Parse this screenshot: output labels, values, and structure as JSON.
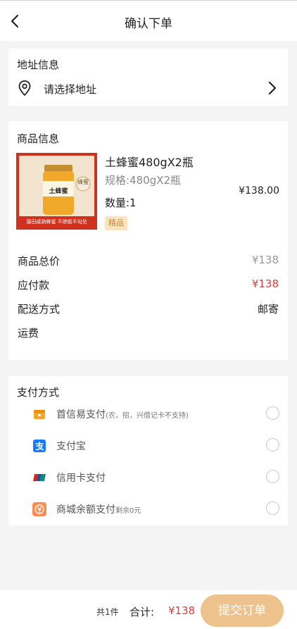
{
  "header": {
    "title": "确认下单"
  },
  "address": {
    "section_title": "地址信息",
    "placeholder": "请选择地址"
  },
  "goods": {
    "section_title": "商品信息",
    "image": {
      "jar_label": "土蜂蜜",
      "side_text": "蜂蜜",
      "banner": "蒲田成熟蜂蜜 不掺假不勾兑"
    },
    "name": "土蜂蜜480gX2瓶",
    "spec": "规格:480gX2瓶",
    "quantity": "数量:1",
    "price": "¥138.00",
    "tag": "精品"
  },
  "summary": {
    "rows": [
      {
        "label": "商品总价",
        "value": "¥138",
        "color": "#999999"
      },
      {
        "label": "应付款",
        "value": "¥138",
        "color": "#e53935"
      },
      {
        "label": "配送方式",
        "value": "邮寄",
        "color": "#222222"
      },
      {
        "label": "运费",
        "value": "",
        "color": "#222222"
      }
    ]
  },
  "payment": {
    "section_title": "支付方式",
    "methods": [
      {
        "label": "首信易支付",
        "note": "(农，招，兴借记卡不支持)",
        "icon": "wallet-icon"
      },
      {
        "label": "支付宝",
        "note": "",
        "icon": "alipay-icon"
      },
      {
        "label": "信用卡支付",
        "note": "",
        "icon": "unionpay-icon"
      },
      {
        "label": "商城余额支付",
        "note": "剩余0元",
        "icon": "balance-icon"
      }
    ]
  },
  "footer": {
    "count": "共1件",
    "total_label": "合计:",
    "total_value": "¥138",
    "submit_label": "提交订单"
  },
  "colors": {
    "accent": "#eec28c",
    "price_red": "#e53935",
    "tag_bg": "#fbe3bf"
  }
}
